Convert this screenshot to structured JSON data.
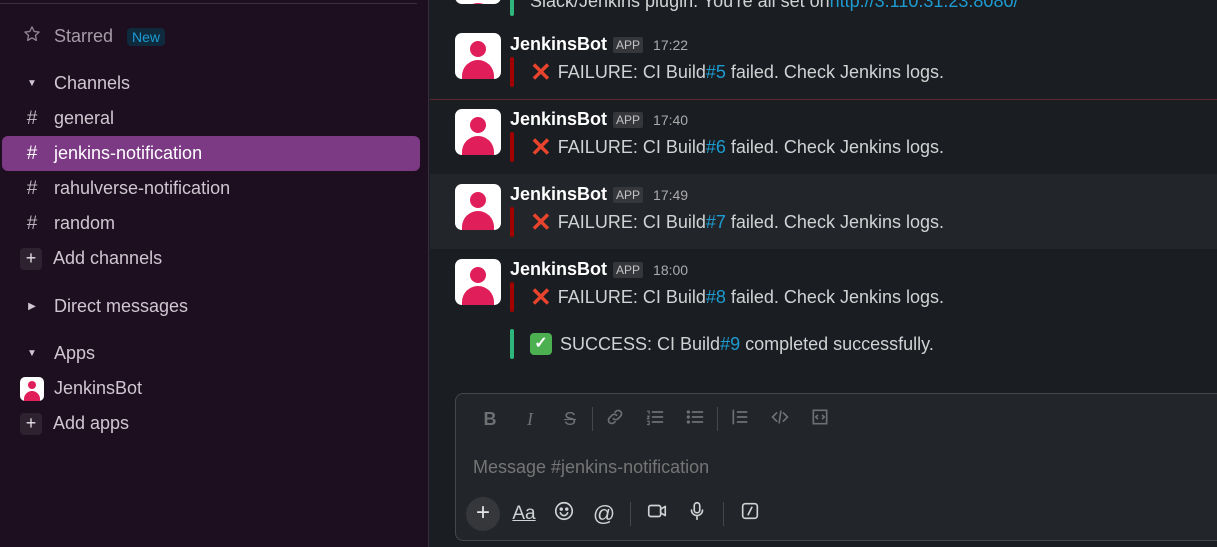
{
  "sidebar": {
    "starred": {
      "label": "Starred",
      "badge": "New"
    },
    "channels_header": "Channels",
    "channels": [
      {
        "name": "general"
      },
      {
        "name": "jenkins-notification"
      },
      {
        "name": "rahulverse-notification"
      },
      {
        "name": "random"
      }
    ],
    "add_channels": "Add channels",
    "direct_messages": "Direct messages",
    "apps_header": "Apps",
    "apps": [
      {
        "name": "JenkinsBot"
      }
    ],
    "add_apps": "Add apps",
    "hash_glyph": "#"
  },
  "messages": {
    "partial_text": "Slack/Jenkins plugin. You're all set on ",
    "partial_link": "http://3.110.31.23:8080/",
    "items": [
      {
        "author": "JenkinsBot",
        "tag": "APP",
        "time": "17:22",
        "status": "FAILURE: CI Build ",
        "build": "#5",
        "rest": " failed. Check Jenkins logs."
      },
      {
        "author": "JenkinsBot",
        "tag": "APP",
        "time": "17:40",
        "status": "FAILURE: CI Build ",
        "build": "#6",
        "rest": " failed. Check Jenkins logs."
      },
      {
        "author": "JenkinsBot",
        "tag": "APP",
        "time": "17:49",
        "status": "FAILURE: CI Build ",
        "build": "#7",
        "rest": " failed. Check Jenkins logs."
      },
      {
        "author": "JenkinsBot",
        "tag": "APP",
        "time": "18:00",
        "status": "FAILURE: CI Build ",
        "build": "#8",
        "rest": " failed. Check Jenkins logs."
      }
    ],
    "success": {
      "status": "SUCCESS: CI Build ",
      "build": "#9",
      "rest": " completed successfully."
    }
  },
  "composer": {
    "placeholder": "Message #jenkins-notification",
    "aa_label": "Aa"
  },
  "colors": {
    "sidebar_bg": "#1d0f1f",
    "active_channel": "#7c3a85",
    "link": "#1d9bd1",
    "failure_bar": "#a30200",
    "success_bar": "#2eb67d",
    "bot_avatar": "#e01e5a"
  },
  "icons": [
    "star-icon",
    "caret-down-icon",
    "caret-right-icon",
    "hash-icon",
    "plus-icon",
    "bold-icon",
    "italic-icon",
    "strikethrough-icon",
    "link-icon",
    "ordered-list-icon",
    "bulleted-list-icon",
    "blockquote-icon",
    "code-icon",
    "code-block-icon",
    "emoji-icon",
    "mention-icon",
    "video-icon",
    "microphone-icon",
    "slash-command-icon",
    "cross-mark-icon",
    "check-mark-icon"
  ]
}
